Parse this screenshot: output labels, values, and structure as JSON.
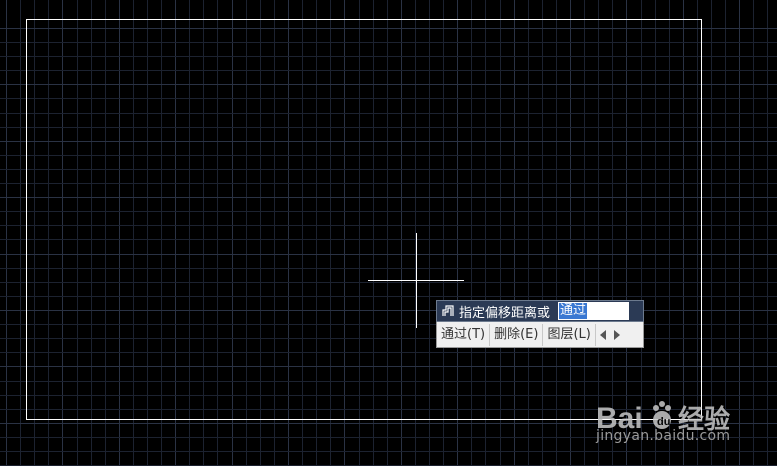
{
  "drawing": {
    "background_color": "#000000",
    "grid_color": "#1c2230",
    "grid_major_color": "#2a3244",
    "outline_color": "#ffffff"
  },
  "dynamic_input": {
    "icon": "offset-command-icon",
    "prompt": "指定偏移距离或",
    "value": "通过",
    "options": [
      {
        "label": "通过(T)"
      },
      {
        "label": "删除(E)"
      },
      {
        "label": "图层(L)"
      }
    ],
    "prev_icon": "triangle-left-icon",
    "next_icon": "triangle-right-icon"
  },
  "watermark": {
    "logo_text": "Bai",
    "logo_text_tail": "经验",
    "url": "jingyan.baidu.com"
  }
}
